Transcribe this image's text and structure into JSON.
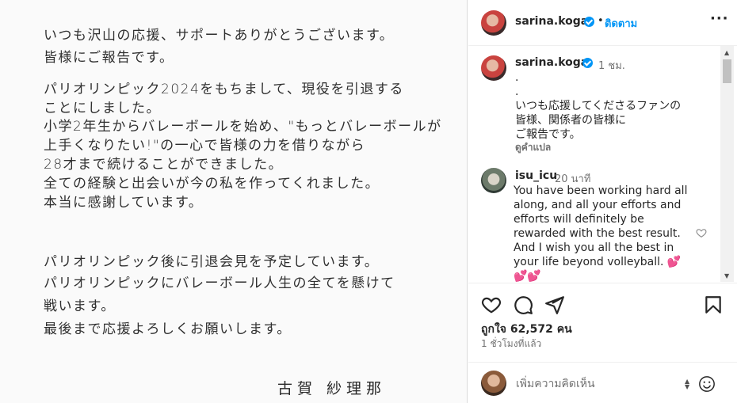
{
  "post_image": {
    "lines": [
      "いつも沢山の応援、サポートありがとうございます。",
      "皆様にご報告です。",
      "パリオリンピック2024をもちまして、現役を引退する",
      "ことにしました。",
      "小学2年生からバレーボールを始め、\"もっとバレーボールが",
      "上手くなりたい!\"の一心で皆様の力を借りながら",
      "28才まで続けることができました。",
      "全ての経験と出会いが今の私を作ってくれました。",
      "本当に感謝しています。",
      "パリオリンピック後に引退会見を予定しています。",
      "パリオリンピックにバレーボール人生の全てを懸けて",
      "戦います。",
      "最後まで応援よろしくお願いします。"
    ],
    "signature": "古賀 紗理那"
  },
  "header": {
    "username": "sarina.koga",
    "dot": "•",
    "follow_label": "ติดตาม",
    "more_label": "···",
    "verified_icon": "verified-badge-icon"
  },
  "caption": {
    "username": "sarina.koga",
    "time": "1 ชม.",
    "text": ".\n.\nいつも応援してくださるファンの\n皆様、関係者の皆様に\nご報告です。",
    "translate_label": "ดูคำแปล"
  },
  "comment": {
    "username": "isu_icu",
    "time": "20 นาที",
    "text": "You have been working hard all\nalong, and all your efforts and\nefforts will definitely be\nrewarded with the best result.\nAnd I wish you all the best in\nyour life beyond volleyball. 💕\n💕💕",
    "like_icon": "heart-outline-icon"
  },
  "actions": {
    "icons": [
      "heart-icon",
      "comment-icon",
      "share-icon",
      "bookmark-icon"
    ],
    "likes_text": "ถูกใจ 62,572 คน",
    "time_ago": "1 ชั่วโมงที่แล้ว"
  },
  "add_comment": {
    "placeholder": "เพิ่มความคิดเห็น",
    "emoji_icon": "emoji-icon"
  },
  "colors": {
    "accent": "#0095f6",
    "text": "#262626",
    "muted": "#737373",
    "divider": "#efefef"
  }
}
